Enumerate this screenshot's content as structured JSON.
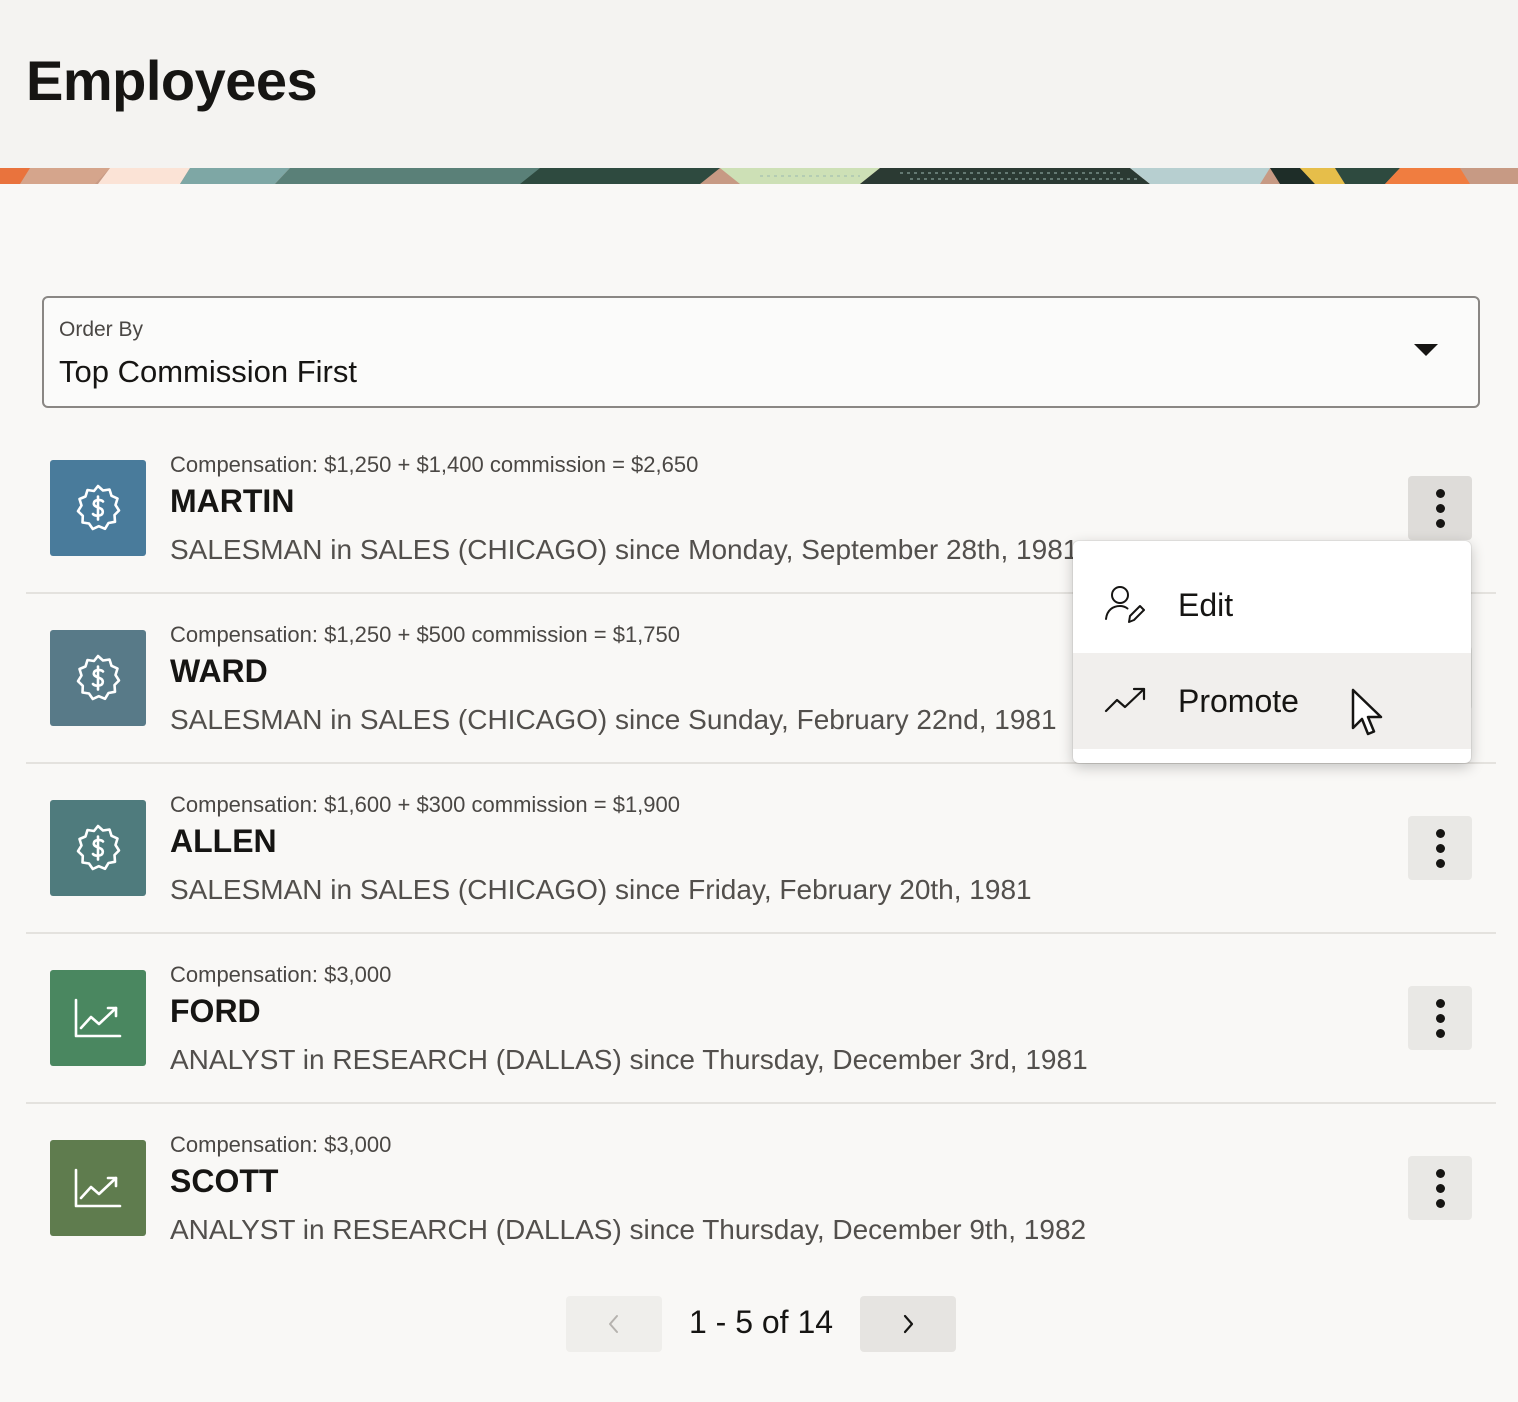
{
  "page": {
    "title": "Employees"
  },
  "order_by": {
    "label": "Order By",
    "value": "Top Commission First"
  },
  "employees": [
    {
      "compensation": "Compensation: $1,250 + $1,400 commission = $2,650",
      "name": "MARTIN",
      "description": "SALESMAN in SALES (CHICAGO) since Monday, September 28th, 1981",
      "icon": "dollar-badge-icon",
      "color": "#497b9b"
    },
    {
      "compensation": "Compensation: $1,250 + $500 commission = $1,750",
      "name": "WARD",
      "description": "SALESMAN in SALES (CHICAGO) since Sunday, February 22nd, 1981",
      "icon": "dollar-badge-icon",
      "color": "#587a88"
    },
    {
      "compensation": "Compensation: $1,600 + $300 commission = $1,900",
      "name": "ALLEN",
      "description": "SALESMAN in SALES (CHICAGO) since Friday, February 20th, 1981",
      "icon": "dollar-badge-icon",
      "color": "#4f7b7d"
    },
    {
      "compensation": "Compensation: $3,000",
      "name": "FORD",
      "description": "ANALYST in RESEARCH (DALLAS) since Thursday, December 3rd, 1981",
      "icon": "trend-chart-icon",
      "color": "#4a8760"
    },
    {
      "compensation": "Compensation: $3,000",
      "name": "SCOTT",
      "description": "ANALYST in RESEARCH (DALLAS) since Thursday, December 9th, 1982",
      "icon": "trend-chart-icon",
      "color": "#5f7c4e"
    }
  ],
  "menu": {
    "items": [
      {
        "label": "Edit",
        "icon": "edit-user-icon"
      },
      {
        "label": "Promote",
        "icon": "trending-up-icon"
      }
    ]
  },
  "pagination": {
    "text": "1 - 5 of 14"
  }
}
